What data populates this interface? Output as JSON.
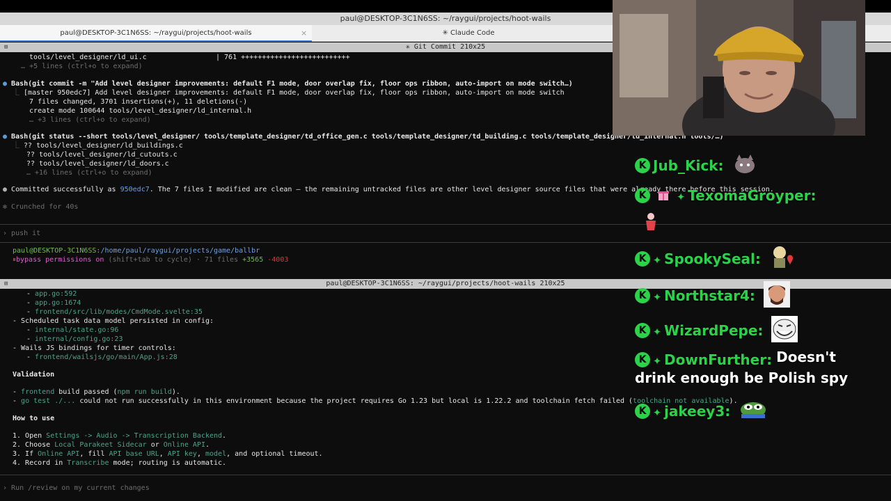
{
  "window": {
    "title": "paul@DESKTOP-3C1N6SS: ~/raygui/projects/hoot-wails",
    "tabs": [
      {
        "label": "paul@DESKTOP-3C1N6SS: ~/raygui/projects/hoot-wails",
        "close": "×"
      },
      {
        "label": "✳ Claude Code"
      }
    ]
  },
  "pane_top": {
    "header": "✳ Git Commit 210x25",
    "lines": {
      "l1a": "  tools/level_designer/ld_ui.c",
      "l1b": "| 761 ++++++++++++++++++++++++++",
      "l2": "  … +5 lines (ctrl+o to expand)",
      "bash1": "Bash(git commit -m \"Add level designer improvements: default F1 mode, door overlap fix, floor ops ribbon, auto-import on mode switch…)",
      "out1": "[master 950edc7] Add level designer improvements: default F1 mode, door overlap fix, floor ops ribbon, auto-import on mode switch",
      "out2": "  7 files changed, 3701 insertions(+), 11 deletions(-)",
      "out3": "  create mode 100644 tools/level_designer/ld_internal.h",
      "out4": "  … +3 lines (ctrl+o to expand)",
      "bash2": "Bash(git status --short tools/level_designer/ tools/template_designer/td_office_gen.c tools/template_designer/td_building.c tools/template_designer/td_internal.h tools/…)",
      "st1": "?? tools/level_designer/ld_buildings.c",
      "st2": "?? tools/level_designer/ld_cutouts.c",
      "st3": "?? tools/level_designer/ld_doors.c",
      "st4": "… +16 lines (ctrl+o to expand)",
      "commit_pre": "Committed successfully as ",
      "commit_hash": "950edc7",
      "commit_post": ". The 7 files I modified are clean — the remaining untracked files are other level designer source files that were already there before this session.",
      "crunched": "Crunched for 40s",
      "prompt": "push it",
      "path_user": "paul@DESKTOP-3C1N6SS",
      "path_dir": ":/home/paul/raygui/projects/game/ballbr",
      "bypass": "bypass permissions on",
      "bypass_rest": " (shift+tab to cycle) · 71 files ",
      "plus": "+3565",
      "minus": " -4003"
    }
  },
  "pane_bottom": {
    "header": "paul@DESKTOP-3C1N6SS: ~/raygui/projects/hoot-wails 210x25",
    "lines": {
      "b1": "app.go:592",
      "b2": "app.go:1674",
      "b3": "frontend/src/lib/modes/CmdMode.svelte:35",
      "b4": "- Scheduled task data model persisted in config:",
      "b5": "internal/state.go:96",
      "b6": "internal/config.go:23",
      "b7": "- Wails JS bindings for timer controls:",
      "b8": "frontend/wailsjs/go/main/App.js:28",
      "validation": "Validation",
      "v1a": "frontend",
      "v1b": " build passed (",
      "v1c": "npm run build",
      "v1d": ").",
      "v2a": "go test ./...",
      "v2b": " could not run successfully in this environment because the project requires Go 1.23 but local is 1.22.2 and toolchain fetch failed (",
      "v2c": "toolchain not available",
      "v2d": ").",
      "howto": "How to use",
      "h1a": "1. Open ",
      "h1b": "Settings -> Audio -> Transcription Backend",
      "h1c": ".",
      "h2a": "2. Choose ",
      "h2b": "Local Parakeet Sidecar",
      "h2c": " or ",
      "h2d": "Online API",
      "h2e": ".",
      "h3a": "3. If ",
      "h3b": "Online API",
      "h3c": ", fill ",
      "h3d": "API base URL",
      "h3e": ", ",
      "h3f": "API key",
      "h3g": ", ",
      "h3h": "model",
      "h3i": ", and optional timeout.",
      "h4a": "4. Record in ",
      "h4b": "Transcribe",
      "h4c": " mode; routing is automatic.",
      "input_placeholder": "Run /review on my current changes"
    }
  },
  "chat": [
    {
      "user": "Jub_Kick:",
      "message": "",
      "emote": "cat-emote"
    },
    {
      "user": "TexomaGroyper:",
      "message": "",
      "emote": "dance-emote"
    },
    {
      "user": "SpookySeal:",
      "message": "",
      "emote": "heart-emote"
    },
    {
      "user": "Northstar4:",
      "message": "",
      "emote": "face-emote"
    },
    {
      "user": "WizardPepe:",
      "message": "",
      "emote": "trollface-emote"
    },
    {
      "user": "DownFurther:",
      "message": "Doesn't",
      "message2": "drink enough be Polish spy"
    },
    {
      "user": "jakeey3:",
      "message": "",
      "emote": "pepe-emote"
    }
  ]
}
